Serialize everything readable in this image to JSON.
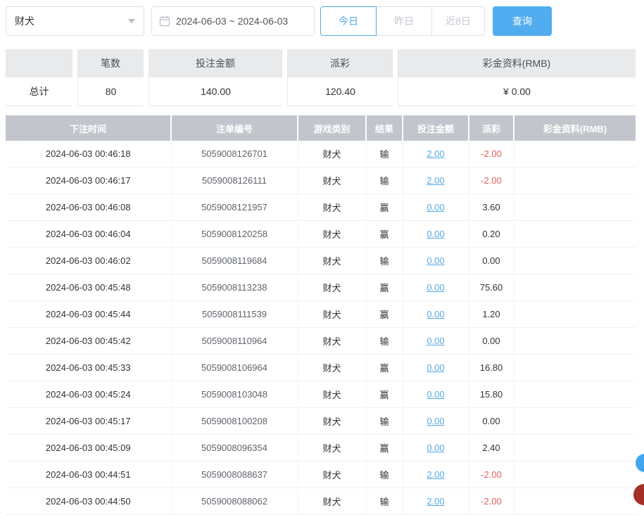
{
  "toolbar": {
    "game_select": {
      "value": "财犬"
    },
    "date_range": {
      "value": "2024-06-03 ~ 2024-06-03"
    },
    "quick_filters": [
      {
        "label": "今日",
        "active": true
      },
      {
        "label": "昨日",
        "active": false
      },
      {
        "label": "近8日",
        "active": false
      }
    ],
    "query_button": "查询"
  },
  "summary": {
    "headers": [
      "",
      "笔数",
      "投注金额",
      "派彩",
      "彩金资料(RMB)"
    ],
    "total_label": "总计",
    "values": {
      "count": "80",
      "bet_amount": "140.00",
      "payout": "120.40",
      "bonus": "¥ 0.00"
    }
  },
  "bets_table": {
    "headers": [
      "下注时间",
      "注单编号",
      "游戏类别",
      "结果",
      "投注金额",
      "派彩",
      "彩金资料(RMB)"
    ],
    "rows": [
      {
        "time": "2024-06-03 00:46:18",
        "order_no": "5059008126701",
        "game": "财犬",
        "result": "输",
        "bet_amount": "2.00",
        "payout": "-2.00",
        "bonus": ""
      },
      {
        "time": "2024-06-03 00:46:17",
        "order_no": "5059008126111",
        "game": "财犬",
        "result": "输",
        "bet_amount": "2.00",
        "payout": "-2.00",
        "bonus": ""
      },
      {
        "time": "2024-06-03 00:46:08",
        "order_no": "5059008121957",
        "game": "财犬",
        "result": "赢",
        "bet_amount": "0.00",
        "payout": "3.60",
        "bonus": ""
      },
      {
        "time": "2024-06-03 00:46:04",
        "order_no": "5059008120258",
        "game": "财犬",
        "result": "赢",
        "bet_amount": "0.00",
        "payout": "0.20",
        "bonus": ""
      },
      {
        "time": "2024-06-03 00:46:02",
        "order_no": "5059008119684",
        "game": "财犬",
        "result": "输",
        "bet_amount": "0.00",
        "payout": "0.00",
        "bonus": ""
      },
      {
        "time": "2024-06-03 00:45:48",
        "order_no": "5059008113238",
        "game": "财犬",
        "result": "赢",
        "bet_amount": "0.00",
        "payout": "75.60",
        "bonus": ""
      },
      {
        "time": "2024-06-03 00:45:44",
        "order_no": "5059008111539",
        "game": "财犬",
        "result": "赢",
        "bet_amount": "0.00",
        "payout": "1.20",
        "bonus": ""
      },
      {
        "time": "2024-06-03 00:45:42",
        "order_no": "5059008110964",
        "game": "财犬",
        "result": "输",
        "bet_amount": "0.00",
        "payout": "0.00",
        "bonus": ""
      },
      {
        "time": "2024-06-03 00:45:33",
        "order_no": "5059008106964",
        "game": "财犬",
        "result": "赢",
        "bet_amount": "0.00",
        "payout": "16.80",
        "bonus": ""
      },
      {
        "time": "2024-06-03 00:45:24",
        "order_no": "5059008103048",
        "game": "财犬",
        "result": "赢",
        "bet_amount": "0.00",
        "payout": "15.80",
        "bonus": ""
      },
      {
        "time": "2024-06-03 00:45:17",
        "order_no": "5059008100208",
        "game": "财犬",
        "result": "输",
        "bet_amount": "0.00",
        "payout": "0.00",
        "bonus": ""
      },
      {
        "time": "2024-06-03 00:45:09",
        "order_no": "5059008096354",
        "game": "财犬",
        "result": "赢",
        "bet_amount": "0.00",
        "payout": "2.40",
        "bonus": ""
      },
      {
        "time": "2024-06-03 00:44:51",
        "order_no": "5059008088637",
        "game": "财犬",
        "result": "输",
        "bet_amount": "2.00",
        "payout": "-2.00",
        "bonus": ""
      },
      {
        "time": "2024-06-03 00:44:50",
        "order_no": "5059008088062",
        "game": "财犬",
        "result": "输",
        "bet_amount": "2.00",
        "payout": "-2.00",
        "bonus": ""
      }
    ]
  },
  "colors": {
    "accent_blue": "#53a8e8",
    "query_button_blue": "#51adf0",
    "negative_red": "#e45c5c",
    "table_header_bg": "#c2c6cc",
    "summary_header_bg": "#e9eaec",
    "floating_blue": "#41a6ee",
    "floating_red": "#a43028"
  }
}
